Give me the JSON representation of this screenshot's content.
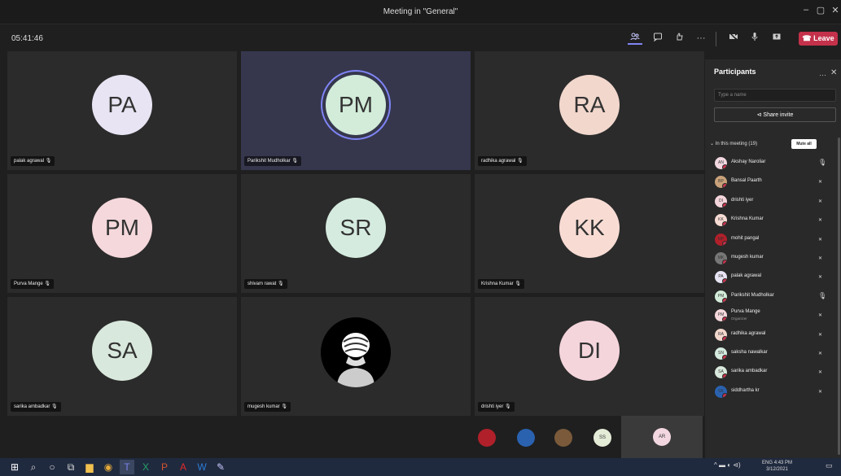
{
  "window": {
    "title": "Meeting in \"General\"",
    "minimize": "–",
    "restore": "▢",
    "close": "✕"
  },
  "toolbar": {
    "timer": "05:41:46",
    "icons": [
      "participants-icon",
      "chat-icon",
      "reactions-icon",
      "more-icon",
      "camera-off-icon",
      "mic-icon",
      "share-icon"
    ],
    "leave_label": "Leave"
  },
  "tiles": [
    {
      "initials": "PA",
      "name": "palak agrawal",
      "color": "#e8e4f3",
      "speaking": false,
      "photo": false
    },
    {
      "initials": "PM",
      "name": "Parikshit Mudholkar",
      "color": "#d2ecd9",
      "speaking": true,
      "photo": false
    },
    {
      "initials": "RA",
      "name": "radhika agrawal",
      "color": "#f2d7cd",
      "speaking": false,
      "photo": false
    },
    {
      "initials": "PM",
      "name": "Purva Mange",
      "color": "#f5d8dc",
      "speaking": false,
      "photo": false
    },
    {
      "initials": "SR",
      "name": "shivam rawat",
      "color": "#d5ebdf",
      "speaking": false,
      "photo": false
    },
    {
      "initials": "KK",
      "name": "Krishna Kumar",
      "color": "#f8dcd4",
      "speaking": false,
      "photo": false
    },
    {
      "initials": "SA",
      "name": "sarika ambadkar",
      "color": "#d9e8dc",
      "speaking": false,
      "photo": false
    },
    {
      "initials": "",
      "name": "mugesh kumar",
      "color": "#000000",
      "speaking": false,
      "photo": true
    },
    {
      "initials": "DI",
      "name": "drishti iyer",
      "color": "#f5d5dc",
      "speaking": false,
      "photo": false
    }
  ],
  "overflow": {
    "avatars": [
      {
        "initials": "",
        "color": "#b0202a"
      },
      {
        "initials": "",
        "color": "#2a62b0"
      },
      {
        "initials": "",
        "color": "#7a5a3a"
      },
      {
        "initials": "SS",
        "color": "#e4ecd8"
      }
    ],
    "self_initials": "AR",
    "self_color": "#f2d7e1"
  },
  "participants": {
    "title": "Participants",
    "more": "…",
    "close": "✕",
    "search_placeholder": "Type a name",
    "share_label": "Share invite",
    "section_label": "In this meeting (19)",
    "mute_all": "Mute all",
    "list": [
      {
        "name": "Akshay Naroliar",
        "role": "",
        "initials": "AN",
        "color": "#f2d7e1",
        "mic": "on"
      },
      {
        "name": "Bansal Paarth",
        "role": "",
        "initials": "BP",
        "color": "#c9a27a",
        "mic": "off"
      },
      {
        "name": "drishti iyer",
        "role": "",
        "initials": "DI",
        "color": "#f5d5dc",
        "mic": "off"
      },
      {
        "name": "Krishna Kumar",
        "role": "",
        "initials": "KK",
        "color": "#f8dcd4",
        "mic": "off"
      },
      {
        "name": "mohit pangal",
        "role": "",
        "initials": "MP",
        "color": "#b0202a",
        "mic": "off"
      },
      {
        "name": "mugesh kumar",
        "role": "",
        "initials": "MK",
        "color": "#777777",
        "mic": "off"
      },
      {
        "name": "palak agrawal",
        "role": "",
        "initials": "PA",
        "color": "#e8e4f3",
        "mic": "off"
      },
      {
        "name": "Parikshit Mudholkar",
        "role": "",
        "initials": "PM",
        "color": "#d2ecd9",
        "mic": "on"
      },
      {
        "name": "Purva Mange",
        "role": "Organizer",
        "initials": "PM",
        "color": "#f5d8dc",
        "mic": "off"
      },
      {
        "name": "radhika agrawal",
        "role": "",
        "initials": "RA",
        "color": "#f2d7cd",
        "mic": "off"
      },
      {
        "name": "saksha nawalkar",
        "role": "",
        "initials": "SN",
        "color": "#d5ebdf",
        "mic": "off"
      },
      {
        "name": "sarika ambadkar",
        "role": "",
        "initials": "SA",
        "color": "#d9e8dc",
        "mic": "off"
      },
      {
        "name": "siddhartha kr",
        "role": "",
        "initials": "SK",
        "color": "#2a62b0",
        "mic": "off"
      }
    ]
  },
  "taskbar": {
    "apps": [
      "windows-icon",
      "search-icon",
      "cortana-icon",
      "task-view-icon",
      "file-explorer-icon",
      "chrome-icon",
      "teams-icon",
      "excel-icon",
      "powerpoint-icon",
      "acrobat-icon",
      "word-icon",
      "paint-icon"
    ],
    "tray": "^ ▬ ◐ ⊲)",
    "lang": "ENG",
    "time": "4:43 PM",
    "date": "3/12/2021"
  }
}
